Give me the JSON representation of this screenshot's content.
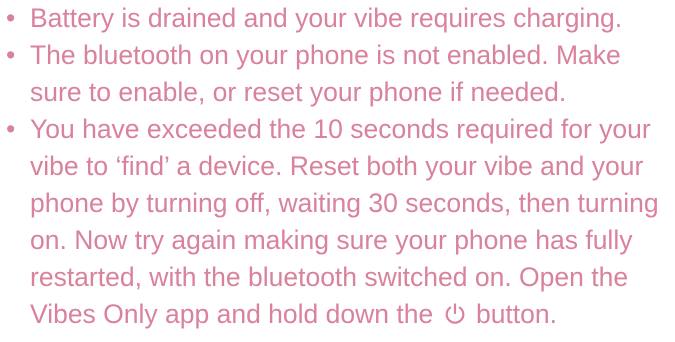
{
  "bullet_glyph": "•",
  "items": [
    {
      "text": "Battery is drained and your vibe requires charging."
    },
    {
      "text": "The bluetooth on your phone is not enabled. Make sure to enable, or reset your phone if needed."
    },
    {
      "text_before_icon": "You have exceeded the 10 seconds required for your vibe to ‘find’ a device. Reset both your vibe and your phone by turning off, waiting 30 seconds, then turning on. Now try again making sure your phone has fully restarted, with the bluetooth switched on. Open the Vibes Only app and hold down the",
      "icon": "power-icon",
      "text_after_icon": "button."
    }
  ],
  "colors": {
    "text": "#d9829c"
  }
}
